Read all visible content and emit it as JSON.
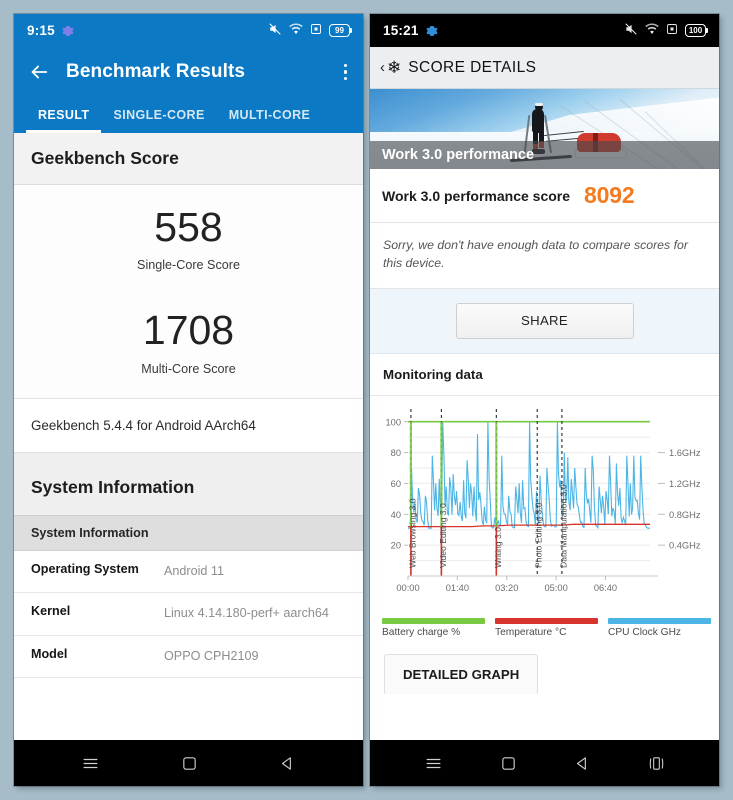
{
  "background_color": "#a6bdc9",
  "left_phone": {
    "statusbar": {
      "time": "9:15",
      "gear_icon": "gear-icon",
      "icons": [
        "vibrate-mute-icon",
        "wifi-icon",
        "square-box-icon"
      ],
      "battery_level": "99"
    },
    "appbar": {
      "back_icon": "back-arrow-icon",
      "title": "Benchmark Results",
      "overflow_icon": "overflow-menu-icon"
    },
    "tabs": [
      {
        "label": "RESULT",
        "active": true
      },
      {
        "label": "SINGLE-CORE",
        "active": false
      },
      {
        "label": "MULTI-CORE",
        "active": false
      }
    ],
    "score_section": {
      "heading": "Geekbench Score",
      "single_core_value": "558",
      "single_core_label": "Single-Core Score",
      "multi_core_value": "1708",
      "multi_core_label": "Multi-Core Score"
    },
    "version_line": "Geekbench 5.4.4 for Android AArch64",
    "system_information": {
      "heading": "System Information",
      "table_header": "System Information",
      "rows": [
        {
          "key": "Operating System",
          "value": "Android 11"
        },
        {
          "key": "Kernel",
          "value": "Linux 4.14.180-perf+ aarch64"
        },
        {
          "key": "Model",
          "value": "OPPO CPH2109"
        }
      ]
    },
    "navbar": [
      "menu-icon",
      "home-icon",
      "back-icon"
    ]
  },
  "right_phone": {
    "statusbar": {
      "time": "15:21",
      "gear_icon": "gear-icon",
      "icons": [
        "vibrate-mute-icon",
        "wifi-icon",
        "square-box-icon"
      ],
      "battery_level": "100"
    },
    "appbar": {
      "back_chevron": "‹",
      "snowflake_icon": "❄",
      "title": "SCORE DETAILS"
    },
    "hero": {
      "caption": "Work 3.0 performance",
      "image_alt": "skier-pulling-sled-on-snow"
    },
    "score_row": {
      "label": "Work 3.0 performance score",
      "value": "8092",
      "value_color": "#f47b20"
    },
    "note": "Sorry, we don't have enough data to compare scores for this device.",
    "share_button": "SHARE",
    "monitoring_heading": "Monitoring data",
    "detailed_graph_button": "DETAILED GRAPH",
    "navbar": [
      "menu-icon",
      "home-icon",
      "back-icon",
      "split-screen-icon"
    ]
  },
  "chart_data": {
    "type": "line",
    "title": "Monitoring data",
    "xlabel": "",
    "ylabel": "",
    "grid": true,
    "legend_position": "bottom",
    "x_ticks": [
      "00:00",
      "01:40",
      "03:20",
      "05:00",
      "06:40"
    ],
    "y_left_ticks": [
      20,
      40,
      60,
      80,
      100
    ],
    "ylim": [
      0,
      105
    ],
    "y_right_ticks": [
      "0.4GHz",
      "0.8GHz",
      "1.2GHz",
      "1.6GHz"
    ],
    "y_right_lim": [
      0,
      2.1
    ],
    "legend": [
      {
        "name": "Battery charge %",
        "color": "#7ac943"
      },
      {
        "name": "Temperature °C",
        "color": "#d6342c"
      },
      {
        "name": "CPU Clock GHz",
        "color": "#4cb5e6"
      }
    ],
    "annotations": [
      {
        "label": "Web Browsing 3.0",
        "x": "00:05",
        "x_frac": 0.012
      },
      {
        "label": "Video Editing 3.0",
        "x": "01:09",
        "x_frac": 0.138
      },
      {
        "label": "Writing 3.0",
        "x": "02:43",
        "x_frac": 0.365
      },
      {
        "label": "Photo Editing 3.0",
        "x": "04:10",
        "x_frac": 0.534
      },
      {
        "label": "Data Manipulation 3.0",
        "x": "04:57",
        "x_frac": 0.636
      }
    ],
    "series": [
      {
        "name": "Battery charge %",
        "color": "#7ac943",
        "axis": "left",
        "values": [
          100,
          100,
          100,
          100,
          100,
          100,
          100,
          100,
          100,
          100,
          100,
          100,
          100,
          100,
          100,
          100,
          100,
          100,
          100,
          100
        ]
      },
      {
        "name": "Temperature °C",
        "color": "#d6342c",
        "axis": "left",
        "values": [
          32,
          32,
          32,
          32,
          32,
          32,
          32.5,
          32.5,
          33,
          33,
          33,
          33,
          33,
          33.5,
          33.5,
          33.5,
          33.5,
          33.5,
          33.5,
          33.5
        ]
      },
      {
        "name": "CPU Clock GHz",
        "color": "#4cb5e6",
        "axis": "right",
        "values": [
          31,
          70,
          48,
          57,
          36,
          52,
          31,
          78,
          60,
          63,
          100,
          58,
          64,
          66,
          55,
          48,
          62,
          75,
          60,
          58,
          92,
          47,
          45,
          100,
          32,
          38,
          36,
          78,
          40,
          52,
          32,
          58,
          60,
          62,
          35,
          100,
          43,
          55,
          65,
          33,
          70,
          36,
          33,
          100,
          62,
          80,
          77,
          63,
          70,
          45,
          35,
          70,
          50,
          78,
          33,
          58,
          52,
          55,
          78,
          44,
          73,
          57,
          38,
          78,
          60,
          78,
          49,
          78,
          34,
          31
        ]
      }
    ]
  }
}
